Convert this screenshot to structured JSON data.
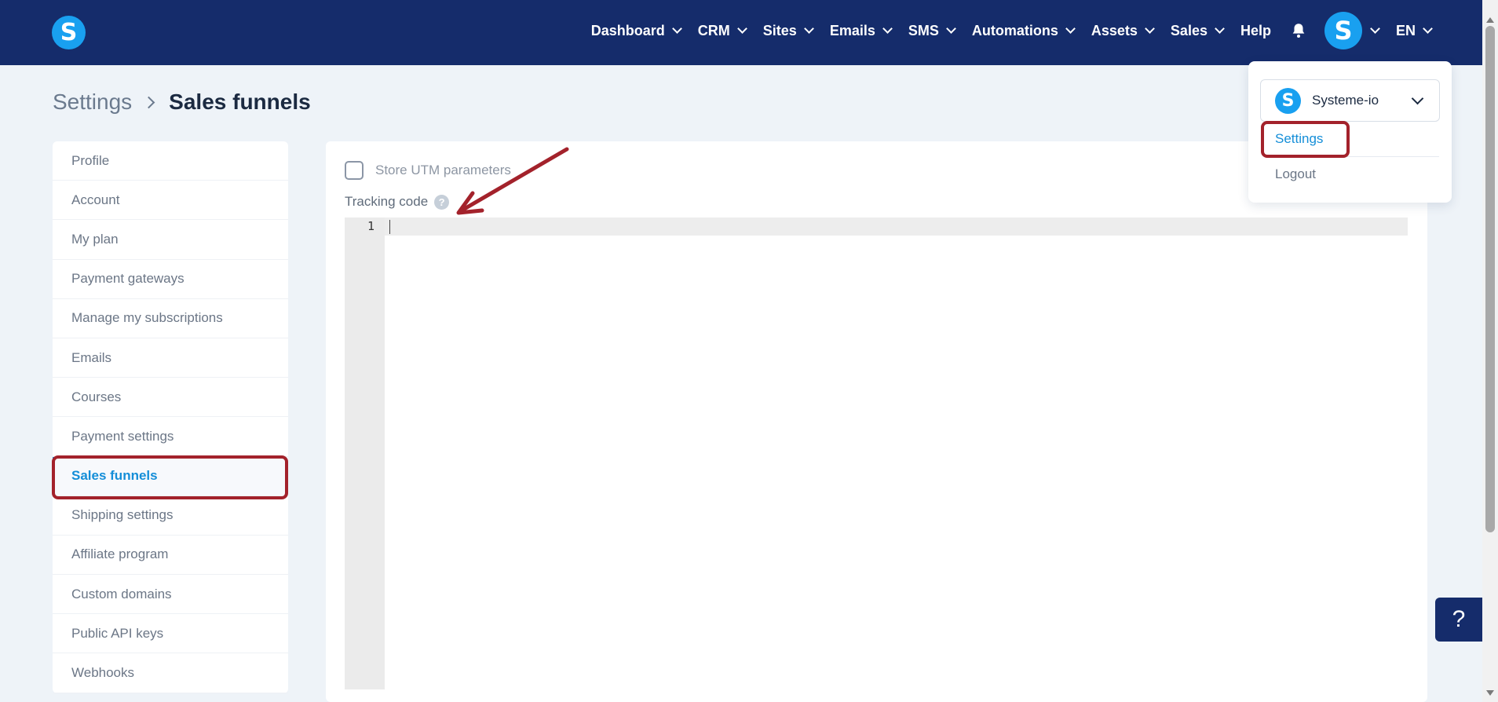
{
  "header": {
    "logo_letter": "S",
    "nav": [
      {
        "label": "Dashboard",
        "has_dropdown": true
      },
      {
        "label": "CRM",
        "has_dropdown": true
      },
      {
        "label": "Sites",
        "has_dropdown": true
      },
      {
        "label": "Emails",
        "has_dropdown": true
      },
      {
        "label": "SMS",
        "has_dropdown": true
      },
      {
        "label": "Automations",
        "has_dropdown": true
      },
      {
        "label": "Assets",
        "has_dropdown": true
      },
      {
        "label": "Sales",
        "has_dropdown": true
      },
      {
        "label": "Help",
        "has_dropdown": false
      }
    ],
    "bell_icon": "bell-icon",
    "avatar_letter": "S",
    "language": "EN"
  },
  "breadcrumb": {
    "parent": "Settings",
    "current": "Sales funnels"
  },
  "sidebar": {
    "items": [
      {
        "label": "Profile"
      },
      {
        "label": "Account"
      },
      {
        "label": "My plan"
      },
      {
        "label": "Payment gateways"
      },
      {
        "label": "Manage my subscriptions"
      },
      {
        "label": "Emails"
      },
      {
        "label": "Courses"
      },
      {
        "label": "Payment settings"
      },
      {
        "label": "Sales funnels",
        "active": true
      },
      {
        "label": "Shipping settings"
      },
      {
        "label": "Affiliate program"
      },
      {
        "label": "Custom domains"
      },
      {
        "label": "Public API keys"
      },
      {
        "label": "Webhooks"
      }
    ]
  },
  "main": {
    "utm_label": "Store UTM parameters",
    "utm_checked": false,
    "tracking_label": "Tracking code",
    "help_glyph": "?",
    "editor": {
      "line_number": "1",
      "content": ""
    }
  },
  "dropdown": {
    "account_logo_letter": "S",
    "account_name": "Systeme-io",
    "settings_label": "Settings",
    "logout_label": "Logout"
  },
  "help_button": {
    "glyph": "?"
  },
  "colors": {
    "topbar": "#152c6b",
    "brand_blue": "#19a0f0",
    "link_blue": "#148ed8",
    "annotation_red": "#a3222b"
  }
}
